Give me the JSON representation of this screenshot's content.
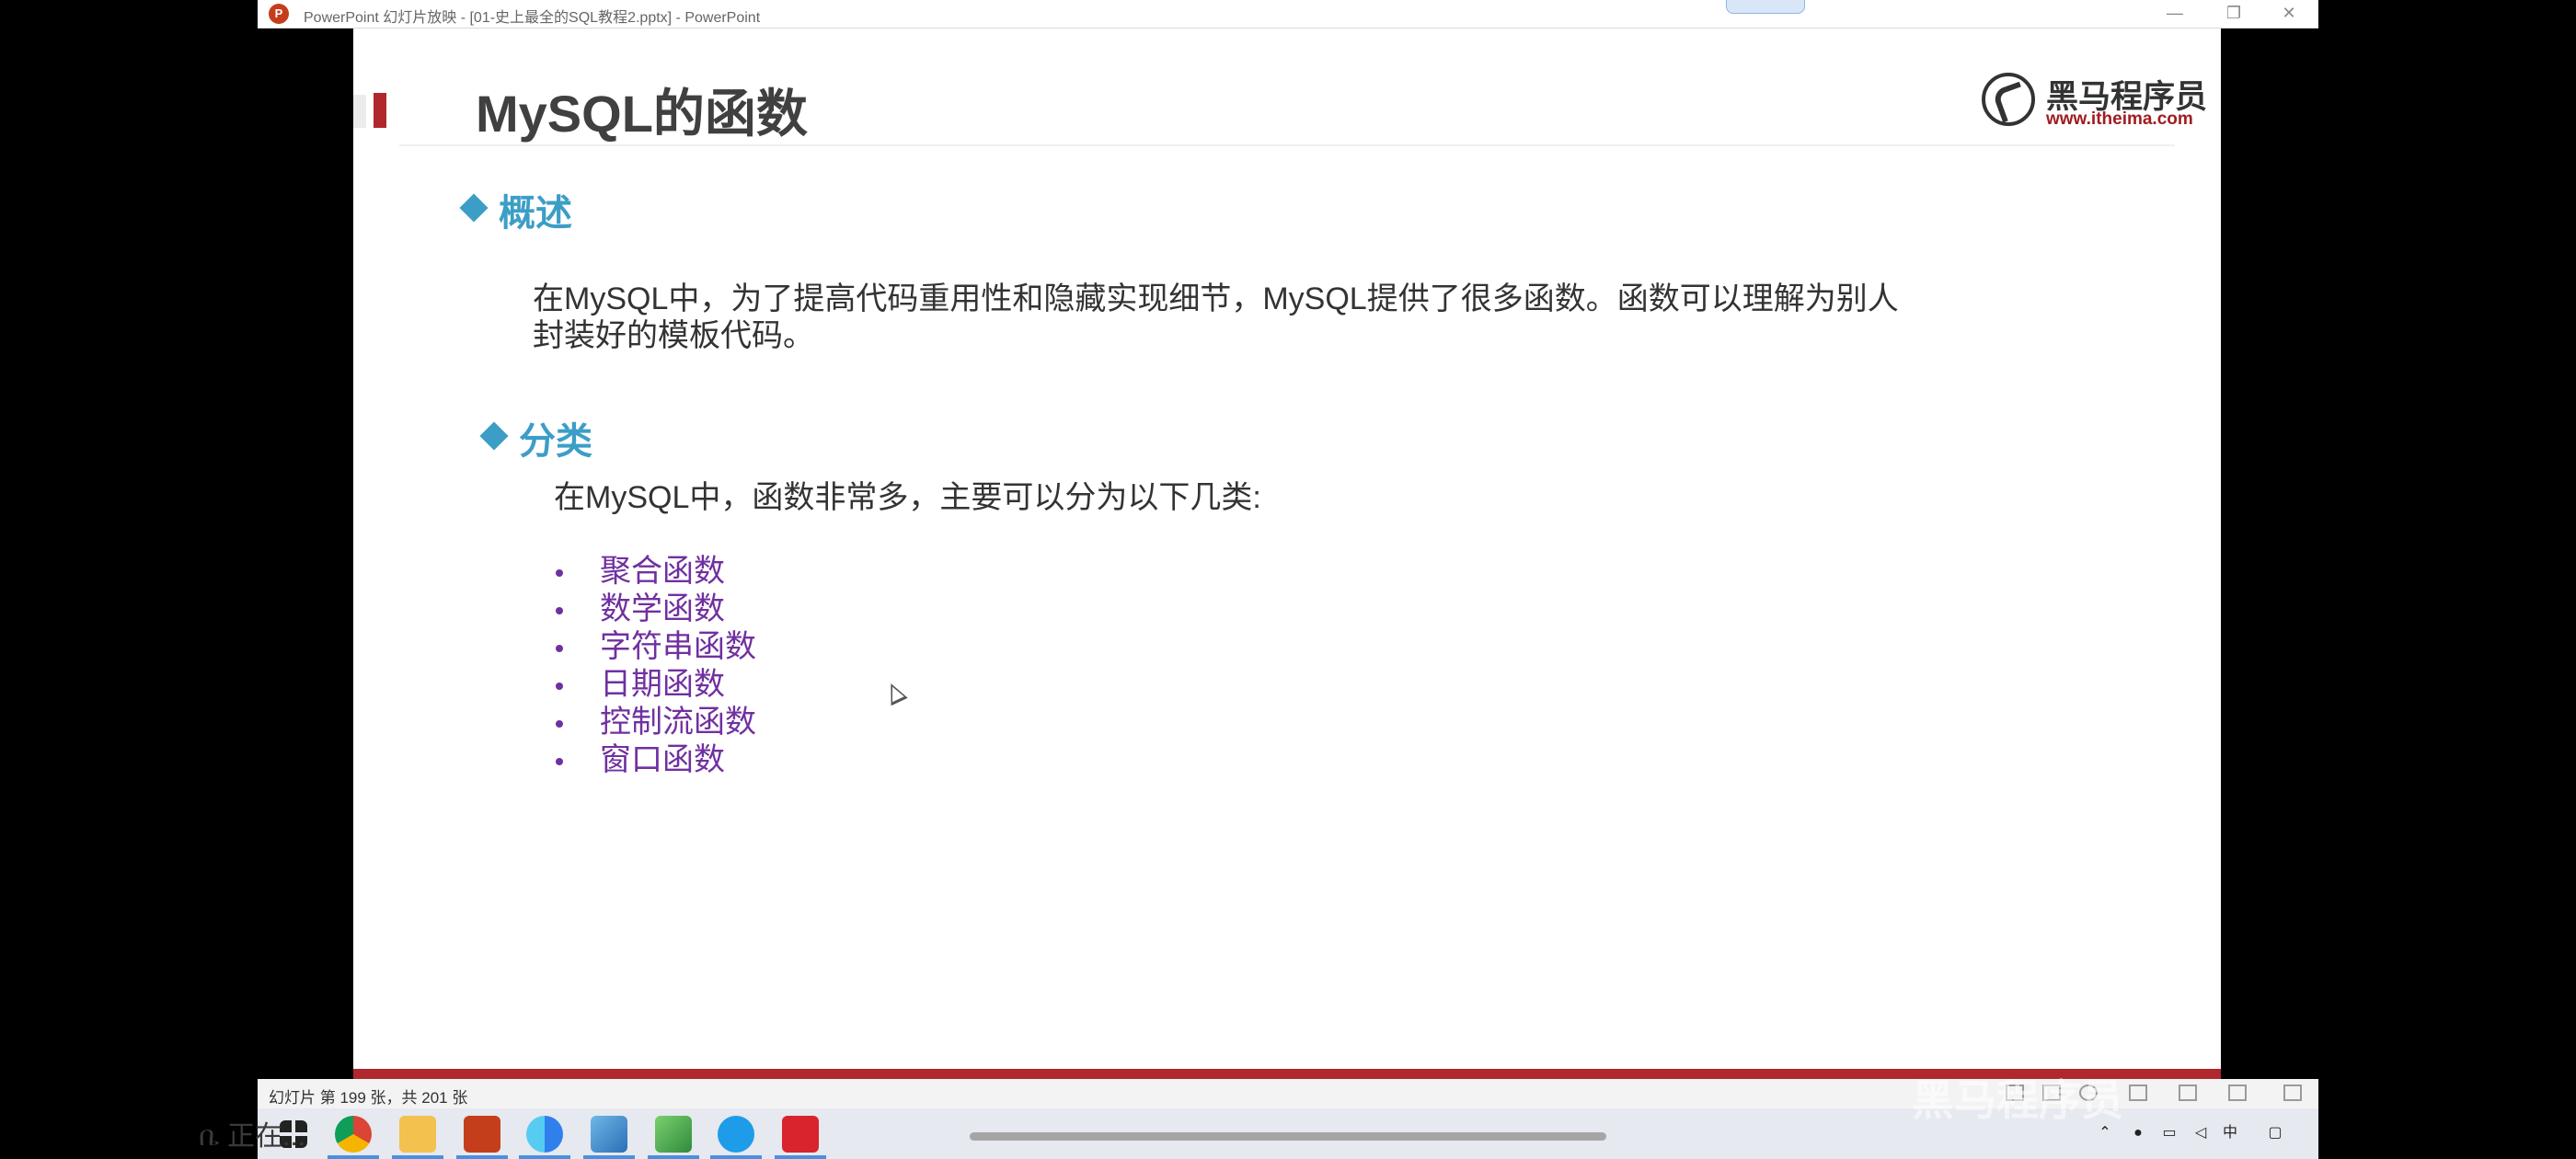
{
  "window": {
    "title": "PowerPoint 幻灯片放映 - [01-史上最全的SQL教程2.pptx] - PowerPoint",
    "app_icon_letter": "P",
    "min_glyph": "—",
    "restore_glyph": "❐",
    "close_glyph": "✕"
  },
  "slide": {
    "title": "MySQL的函数",
    "logo": {
      "brand": "黑马程序员",
      "url": "www.itheima.com"
    },
    "sections": [
      {
        "heading": "概述",
        "lines": [
          "在MySQL中，为了提高代码重用性和隐藏实现细节，MySQL提供了很多函数。函数可以理解为别人",
          "封装好的模板代码。"
        ]
      },
      {
        "heading": "分类",
        "intro": "在MySQL中，函数非常多，主要可以分为以下几类:",
        "bullets": [
          "聚合函数",
          "数学函数",
          "字符串函数",
          "日期函数",
          "控制流函数",
          "窗口函数"
        ]
      }
    ]
  },
  "statusbar": {
    "slide_counter": "幻灯片 第 199 张，共 201 张"
  },
  "taskbar": {
    "apps": [
      "windows-start",
      "chrome",
      "file-explorer",
      "powerpoint",
      "browser",
      "app-blue",
      "app-green",
      "ie",
      "wps"
    ],
    "tray_icons": [
      "chevron-up",
      "microphone",
      "battery",
      "volume",
      "ime",
      "notification"
    ],
    "ime_text": "中",
    "left_ghost_text": "ቤ 正在..."
  },
  "overlay": {
    "watermark": "黑马程序员"
  },
  "colors": {
    "accent_red": "#b0282e",
    "heading_blue": "#3c9ec6",
    "bullet_purple": "#7030a0"
  }
}
